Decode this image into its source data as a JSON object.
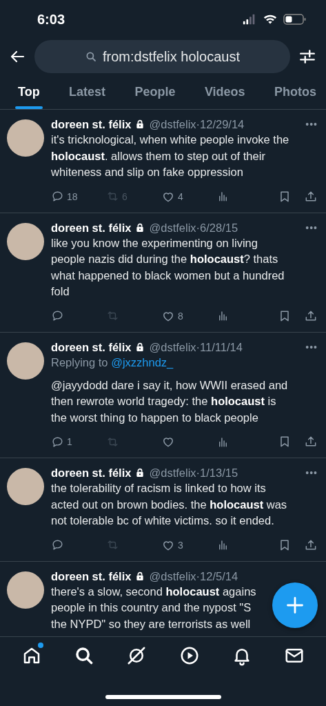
{
  "status_bar": {
    "time": "6:03"
  },
  "search": {
    "value": "from:dstfelix holocaust"
  },
  "tabs": [
    {
      "label": "Top",
      "selected": true
    },
    {
      "label": "Latest",
      "selected": false
    },
    {
      "label": "People",
      "selected": false
    },
    {
      "label": "Videos",
      "selected": false
    },
    {
      "label": "Photos",
      "selected": false
    }
  ],
  "tweets": [
    {
      "name": "doreen st. félix",
      "protected": true,
      "handle_date": "@dstfelix·12/29/14",
      "more": "•••",
      "lines": [
        "it's tricknological, when white people invoke the",
        "**holocaust**. allows them to step out of their",
        "whiteness and slip on fake oppression"
      ],
      "replies": "18",
      "retweets": "6",
      "retweet_disabled": true,
      "likes": "4"
    },
    {
      "name": "doreen st. félix",
      "protected": true,
      "handle_date": "@dstfelix·6/28/15",
      "more": "•••",
      "lines": [
        "like you know the experimenting on living",
        "people nazis did during the **holocaust**? thats",
        "what happened to black women but a hundred",
        "fold"
      ],
      "retweet_disabled": true,
      "likes": "8"
    },
    {
      "name": "doreen st. félix",
      "protected": true,
      "handle_date": "@dstfelix·11/11/14",
      "more": "•••",
      "replying_to": {
        "label": "Replying to",
        "user": "@jxzzhndz_"
      },
      "lines": [
        "@jayydodd dare i say it, how WWII erased and",
        "then rewrote world tragedy: the **holocaust** is",
        "the worst thing to happen to black people"
      ],
      "replies": "1",
      "retweet_disabled": true
    },
    {
      "name": "doreen st. félix",
      "protected": true,
      "handle_date": "@dstfelix·1/13/15",
      "more": "•••",
      "lines": [
        "the tolerability of racism is linked to how its",
        "acted out on brown bodies. the **holocaust** was",
        "not tolerable bc of white victims. so it ended."
      ],
      "retweet_disabled": true,
      "likes": "3"
    },
    {
      "name": "doreen st. félix",
      "protected": true,
      "handle_date": "@dstfelix·12/5/14",
      "lines": [
        "there's a slow, second **holocaust** agains",
        "people in this country and the nypost \"S",
        "the NYPD\" so they are terrorists as well"
      ]
    }
  ],
  "nav": [
    {
      "kind": "home",
      "badge": true
    },
    {
      "kind": "search",
      "badge": false
    },
    {
      "kind": "slash",
      "badge": false
    },
    {
      "kind": "play",
      "badge": false
    },
    {
      "kind": "bell",
      "badge": false
    },
    {
      "kind": "mail",
      "badge": false
    }
  ]
}
